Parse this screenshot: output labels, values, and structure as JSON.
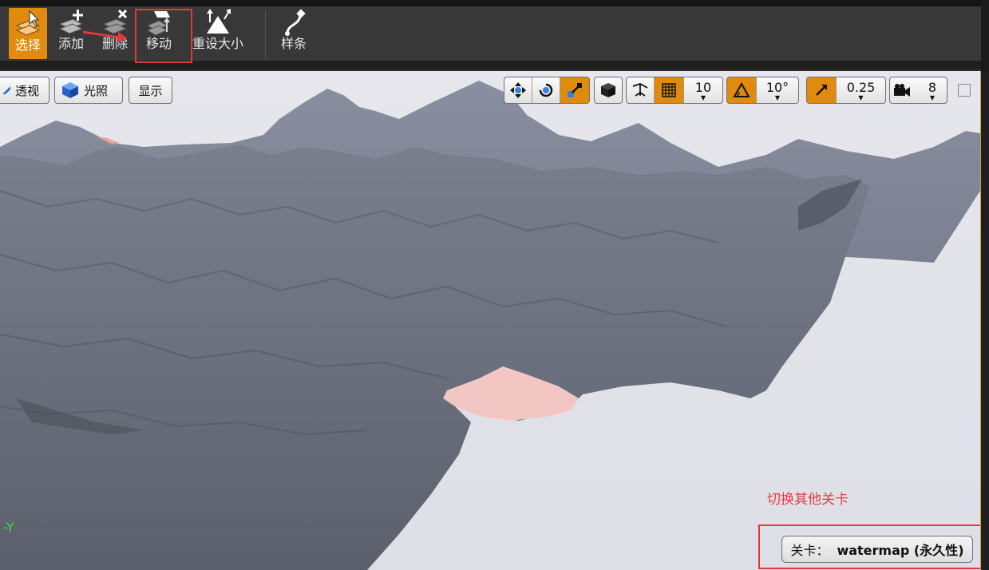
{
  "toolbar": {
    "tools": [
      {
        "label": "选择",
        "icon": "select-icon",
        "active": true
      },
      {
        "label": "添加",
        "icon": "add-icon",
        "active": false
      },
      {
        "label": "删除",
        "icon": "delete-icon",
        "active": false
      },
      {
        "label": "移动",
        "icon": "move-icon",
        "active": false
      },
      {
        "label": "重设大小",
        "icon": "resize-icon",
        "active": false
      },
      {
        "label": "样条",
        "icon": "spline-icon",
        "active": false
      }
    ]
  },
  "viewport": {
    "view_mode": "透视",
    "lighting": "光照",
    "show": "显示",
    "grid_snap": "10",
    "rotation_snap": "10°",
    "scale_snap": "0.25",
    "camera_speed": "8",
    "axis_label": "-Y",
    "annotation": "切换其他关卡",
    "level_label": "关卡：",
    "level_name": "watermap (永久性)"
  },
  "colors": {
    "accent": "#e08a0e",
    "annotation_red": "#e0393e",
    "terrain": "#6d7280",
    "water": "#f2c6c3"
  }
}
